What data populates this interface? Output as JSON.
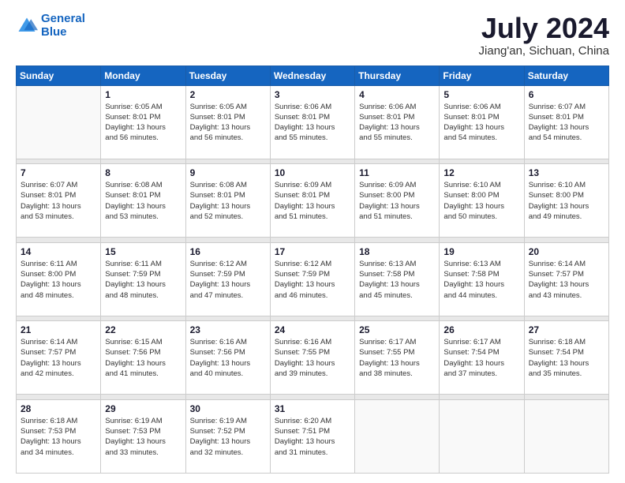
{
  "logo": {
    "line1": "General",
    "line2": "Blue"
  },
  "header": {
    "month": "July 2024",
    "location": "Jiang'an, Sichuan, China"
  },
  "weekdays": [
    "Sunday",
    "Monday",
    "Tuesday",
    "Wednesday",
    "Thursday",
    "Friday",
    "Saturday"
  ],
  "weeks": [
    [
      {
        "day": "",
        "info": ""
      },
      {
        "day": "1",
        "info": "Sunrise: 6:05 AM\nSunset: 8:01 PM\nDaylight: 13 hours\nand 56 minutes."
      },
      {
        "day": "2",
        "info": "Sunrise: 6:05 AM\nSunset: 8:01 PM\nDaylight: 13 hours\nand 56 minutes."
      },
      {
        "day": "3",
        "info": "Sunrise: 6:06 AM\nSunset: 8:01 PM\nDaylight: 13 hours\nand 55 minutes."
      },
      {
        "day": "4",
        "info": "Sunrise: 6:06 AM\nSunset: 8:01 PM\nDaylight: 13 hours\nand 55 minutes."
      },
      {
        "day": "5",
        "info": "Sunrise: 6:06 AM\nSunset: 8:01 PM\nDaylight: 13 hours\nand 54 minutes."
      },
      {
        "day": "6",
        "info": "Sunrise: 6:07 AM\nSunset: 8:01 PM\nDaylight: 13 hours\nand 54 minutes."
      }
    ],
    [
      {
        "day": "7",
        "info": "Sunrise: 6:07 AM\nSunset: 8:01 PM\nDaylight: 13 hours\nand 53 minutes."
      },
      {
        "day": "8",
        "info": "Sunrise: 6:08 AM\nSunset: 8:01 PM\nDaylight: 13 hours\nand 53 minutes."
      },
      {
        "day": "9",
        "info": "Sunrise: 6:08 AM\nSunset: 8:01 PM\nDaylight: 13 hours\nand 52 minutes."
      },
      {
        "day": "10",
        "info": "Sunrise: 6:09 AM\nSunset: 8:01 PM\nDaylight: 13 hours\nand 51 minutes."
      },
      {
        "day": "11",
        "info": "Sunrise: 6:09 AM\nSunset: 8:00 PM\nDaylight: 13 hours\nand 51 minutes."
      },
      {
        "day": "12",
        "info": "Sunrise: 6:10 AM\nSunset: 8:00 PM\nDaylight: 13 hours\nand 50 minutes."
      },
      {
        "day": "13",
        "info": "Sunrise: 6:10 AM\nSunset: 8:00 PM\nDaylight: 13 hours\nand 49 minutes."
      }
    ],
    [
      {
        "day": "14",
        "info": "Sunrise: 6:11 AM\nSunset: 8:00 PM\nDaylight: 13 hours\nand 48 minutes."
      },
      {
        "day": "15",
        "info": "Sunrise: 6:11 AM\nSunset: 7:59 PM\nDaylight: 13 hours\nand 48 minutes."
      },
      {
        "day": "16",
        "info": "Sunrise: 6:12 AM\nSunset: 7:59 PM\nDaylight: 13 hours\nand 47 minutes."
      },
      {
        "day": "17",
        "info": "Sunrise: 6:12 AM\nSunset: 7:59 PM\nDaylight: 13 hours\nand 46 minutes."
      },
      {
        "day": "18",
        "info": "Sunrise: 6:13 AM\nSunset: 7:58 PM\nDaylight: 13 hours\nand 45 minutes."
      },
      {
        "day": "19",
        "info": "Sunrise: 6:13 AM\nSunset: 7:58 PM\nDaylight: 13 hours\nand 44 minutes."
      },
      {
        "day": "20",
        "info": "Sunrise: 6:14 AM\nSunset: 7:57 PM\nDaylight: 13 hours\nand 43 minutes."
      }
    ],
    [
      {
        "day": "21",
        "info": "Sunrise: 6:14 AM\nSunset: 7:57 PM\nDaylight: 13 hours\nand 42 minutes."
      },
      {
        "day": "22",
        "info": "Sunrise: 6:15 AM\nSunset: 7:56 PM\nDaylight: 13 hours\nand 41 minutes."
      },
      {
        "day": "23",
        "info": "Sunrise: 6:16 AM\nSunset: 7:56 PM\nDaylight: 13 hours\nand 40 minutes."
      },
      {
        "day": "24",
        "info": "Sunrise: 6:16 AM\nSunset: 7:55 PM\nDaylight: 13 hours\nand 39 minutes."
      },
      {
        "day": "25",
        "info": "Sunrise: 6:17 AM\nSunset: 7:55 PM\nDaylight: 13 hours\nand 38 minutes."
      },
      {
        "day": "26",
        "info": "Sunrise: 6:17 AM\nSunset: 7:54 PM\nDaylight: 13 hours\nand 37 minutes."
      },
      {
        "day": "27",
        "info": "Sunrise: 6:18 AM\nSunset: 7:54 PM\nDaylight: 13 hours\nand 35 minutes."
      }
    ],
    [
      {
        "day": "28",
        "info": "Sunrise: 6:18 AM\nSunset: 7:53 PM\nDaylight: 13 hours\nand 34 minutes."
      },
      {
        "day": "29",
        "info": "Sunrise: 6:19 AM\nSunset: 7:53 PM\nDaylight: 13 hours\nand 33 minutes."
      },
      {
        "day": "30",
        "info": "Sunrise: 6:19 AM\nSunset: 7:52 PM\nDaylight: 13 hours\nand 32 minutes."
      },
      {
        "day": "31",
        "info": "Sunrise: 6:20 AM\nSunset: 7:51 PM\nDaylight: 13 hours\nand 31 minutes."
      },
      {
        "day": "",
        "info": ""
      },
      {
        "day": "",
        "info": ""
      },
      {
        "day": "",
        "info": ""
      }
    ]
  ]
}
